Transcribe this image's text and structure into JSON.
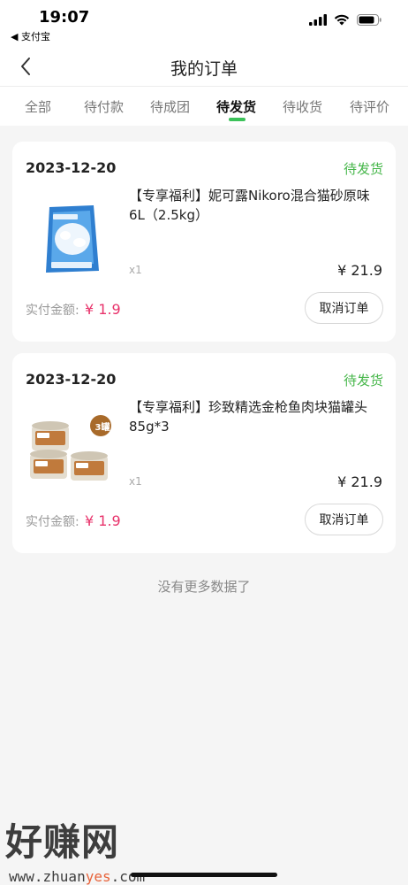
{
  "status_bar": {
    "time": "19:07",
    "back_app": "◀ 支付宝"
  },
  "nav": {
    "title": "我的订单"
  },
  "tabs": [
    {
      "label": "全部"
    },
    {
      "label": "待付款"
    },
    {
      "label": "待成团"
    },
    {
      "label": "待发货",
      "active": true
    },
    {
      "label": "待收货"
    },
    {
      "label": "待评价"
    }
  ],
  "orders": [
    {
      "date": "2023-12-20",
      "status": "待发货",
      "title": "【专享福利】妮可露Nikoro混合猫砂原味6L（2.5kg）",
      "qty": "x1",
      "price": "¥ 21.9",
      "paid_label": "实付金额:",
      "paid_amount": "¥ 1.9",
      "cancel_label": "取消订单"
    },
    {
      "date": "2023-12-20",
      "status": "待发货",
      "title": "【专享福利】珍致精选金枪鱼肉块猫罐头85g*3",
      "qty": "x1",
      "price": "¥ 21.9",
      "paid_label": "实付金额:",
      "paid_amount": "¥ 1.9",
      "cancel_label": "取消订单",
      "badge": "3罐"
    }
  ],
  "footer": {
    "no_more": "没有更多数据了"
  },
  "watermark": {
    "big": "好赚网",
    "small_a": "www.zhuan",
    "small_b": "yes",
    "small_c": ".com"
  },
  "colors": {
    "accent_green": "#45b649",
    "price_pink": "#e8336b"
  }
}
